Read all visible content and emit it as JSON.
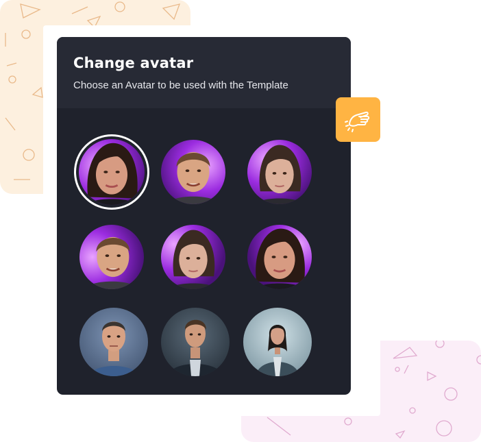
{
  "modal": {
    "title": "Change avatar",
    "subtitle": "Choose an Avatar to be used with the Template"
  },
  "avatars": [
    {
      "id": "photo-woman-dark-hair",
      "style": "photo",
      "background": "purple",
      "selected": true
    },
    {
      "id": "photo-man-short-hair",
      "style": "photo",
      "background": "purple",
      "selected": false
    },
    {
      "id": "photo-young-woman",
      "style": "photo",
      "background": "purple",
      "selected": false
    },
    {
      "id": "photo-man-short-hair-2",
      "style": "photo",
      "background": "purple",
      "selected": false
    },
    {
      "id": "photo-young-woman-2",
      "style": "photo",
      "background": "purple",
      "selected": false
    },
    {
      "id": "photo-woman-dark-hair-2",
      "style": "photo",
      "background": "purple",
      "selected": false
    },
    {
      "id": "3d-man-denim-shirt",
      "style": "3d",
      "background": "slate-blue",
      "selected": false
    },
    {
      "id": "3d-man-dark-jacket",
      "style": "3d",
      "background": "dark-slate",
      "selected": false
    },
    {
      "id": "3d-woman-blazer",
      "style": "3d",
      "background": "teal-gray",
      "selected": false
    }
  ],
  "colors": {
    "modal_bg": "#1f222c",
    "header_bg": "#272a35",
    "accent_badge": "#ffb443",
    "deco_peach": "#fdf0df",
    "deco_pink": "#fbeef8"
  },
  "icons": {
    "badge": "pointing-hand-icon"
  }
}
